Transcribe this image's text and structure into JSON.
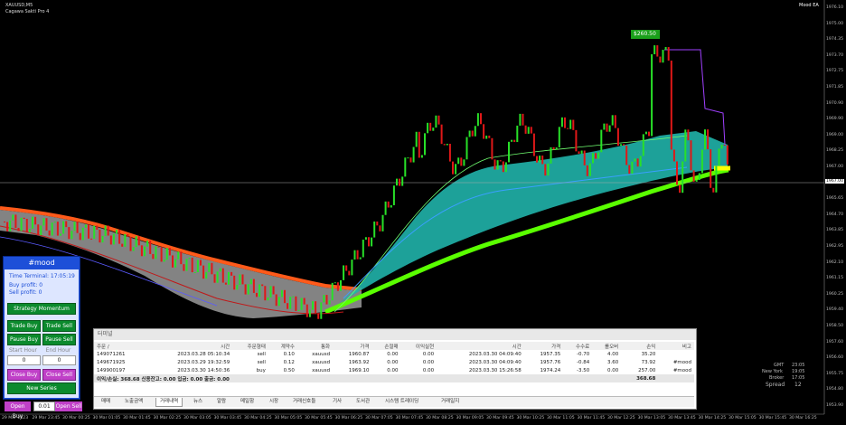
{
  "symbol_line": "XAUUSD,M5",
  "indicator_line": "Cagawa Sakti Pro 4",
  "mood_top": "Mood EA",
  "price_label": "$260.50",
  "colors": {
    "bg": "#000000",
    "up": "#28e028",
    "down": "#e01818",
    "cloud": "#20b2aa",
    "gray_cloud": "#9a9a9a",
    "accent": "#1d4fd8",
    "bright_green": "#5aff00",
    "orange": "#ff5a1a"
  },
  "panel": {
    "title": "#mood",
    "time_terminal": "Time Terminal: 17:05:19",
    "buy_profit": "Buy profit: 0",
    "sell_profit": "Sell profit: 0",
    "strategy": "Strategy Momentum",
    "trade_buy": "Trade Buy",
    "trade_sell": "Trade Sell",
    "pause_buy": "Pause Buy",
    "pause_sell": "Pause Sell",
    "start_hour_label": "Start Hour",
    "end_hour_label": "End Hour",
    "start_hour": "0",
    "end_hour": "0",
    "close_buy": "Close Buy",
    "close_sell": "Close Sell",
    "new_series": "New Series",
    "open_buy": "Open Buy",
    "lot": "0.01",
    "open_sell": "Open Sell"
  },
  "terminal": {
    "title": "터미널",
    "headers": [
      "주문 /",
      "시간",
      "주문형태",
      "계약수",
      "통화",
      "가격",
      "손절매",
      "이익실현",
      "시간",
      "가격",
      "수수료",
      "롤오버",
      "손익",
      "비고"
    ],
    "rows": [
      [
        "149071261",
        "2023.03.28 05:10:34",
        "sell",
        "0.10",
        "xauusd",
        "1960.87",
        "0.00",
        "0.00",
        "2023.03.30 04:09:40",
        "1957.35",
        "-0.70",
        "4.00",
        "35.20",
        ""
      ],
      [
        "149671925",
        "2023.03.29 19:32:59",
        "sell",
        "0.12",
        "xauusd",
        "1963.92",
        "0.00",
        "0.00",
        "2023.03.30 04:09:40",
        "1957.76",
        "-0.84",
        "3.60",
        "73.92",
        "#mood"
      ],
      [
        "149900197",
        "2023.03.30 14:50:36",
        "buy",
        "0.50",
        "xauusd",
        "1969.10",
        "0.00",
        "0.00",
        "2023.03.30 15:26:58",
        "1974.24",
        "-3.50",
        "0.00",
        "257.00",
        "#mood"
      ]
    ],
    "summary_label": "이익/손실: 368.68  신용잔고: 0.00  입금: 0.00  출금: 0.00",
    "summary_value": "368.68",
    "tabs": [
      "매매",
      "노출금액",
      "거래내역",
      "뉴스",
      "알람",
      "메일함",
      "시장",
      "거래신호들",
      "기사",
      "도서관",
      "시스템 트레이딩",
      "거래일지"
    ],
    "active_tab": 2
  },
  "info": {
    "gmt_label": "GMT",
    "gmt": "23:05",
    "ny_label": "New York",
    "ny": "19:05",
    "broker_label": "Broker",
    "broker": "17:05",
    "spread_label": "Spread",
    "spread": "12"
  },
  "price_current": "1967.00",
  "y_axis": [
    "1976.10",
    "1975.00",
    "1974.35",
    "1973.70",
    "1972.75",
    "1971.85",
    "1970.90",
    "1969.90",
    "1969.00",
    "1968.25",
    "1967.00",
    "1966.55",
    "1965.65",
    "1964.70",
    "1963.85",
    "1962.95",
    "1962.10",
    "1961.15",
    "1960.25",
    "1959.40",
    "1958.50",
    "1957.60",
    "1956.60",
    "1955.75",
    "1954.80",
    "1953.90"
  ],
  "x_axis": [
    "29 Mar 2023",
    "29 Mar 23:45",
    "30 Mar 00:25",
    "30 Mar 01:05",
    "30 Mar 01:45",
    "30 Mar 02:25",
    "30 Mar 03:05",
    "30 Mar 03:45",
    "30 Mar 04:25",
    "30 Mar 05:05",
    "30 Mar 05:45",
    "30 Mar 06:25",
    "30 Mar 07:05",
    "30 Mar 07:45",
    "30 Mar 08:25",
    "30 Mar 09:05",
    "30 Mar 09:45",
    "30 Mar 10:25",
    "30 Mar 11:05",
    "30 Mar 11:45",
    "30 Mar 12:25",
    "30 Mar 13:05",
    "30 Mar 13:45",
    "30 Mar 14:25",
    "30 Mar 15:05",
    "30 Mar 15:45",
    "30 Mar 16:25"
  ]
}
